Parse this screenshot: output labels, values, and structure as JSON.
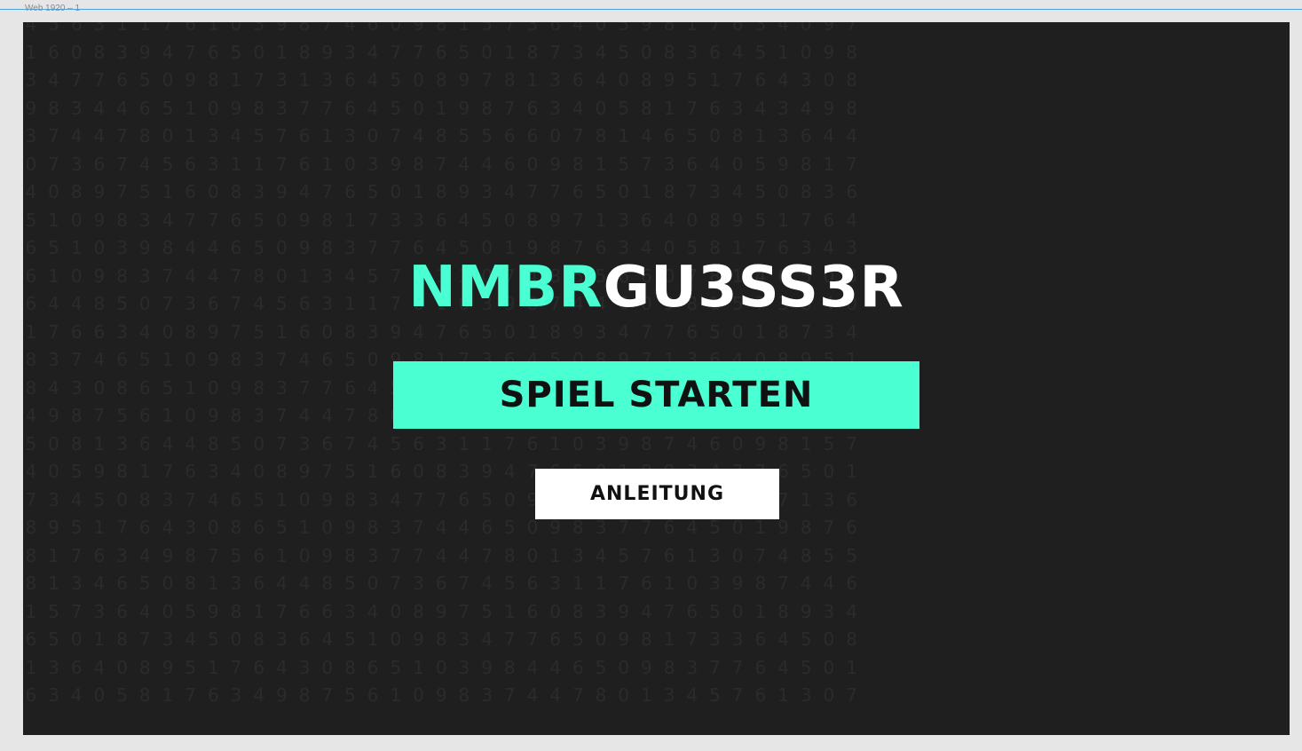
{
  "canvas": {
    "artboard_label": "Web 1920 – 1"
  },
  "title": {
    "accent": "NMBR",
    "rest": "GU3SS3R"
  },
  "buttons": {
    "start_label": "SPIEL STARTEN",
    "guide_label": "ANLEITUNG"
  },
  "background_digits": [
    "4563117610398746098157364059817634097",
    "1608394765018934776501873450836451098",
    "3477650981731364508978136408951764308",
    "9834465109837764501987634058176343498",
    "3744780134576130748556607814650813644",
    "0736745631176103987446098157364059817",
    "4089751608394765018934776501873450836",
    "5109834776509817336450897136408951764",
    "6510398446509837764501987634058176343",
    "6109837447801345761307485566078146508",
    "6448507367456311761039874460981573640",
    "1766340897516083947650189347765018734",
    "8374651098374650981736450897136408951",
    "8430865109837764501987634058176343498",
    "4987561098374478013457613074855660781",
    "5081364485073674563117610398746098157",
    "4059817634089751608394765018934776501",
    "7345083746510983477650981736450897136",
    "8951764308651098374465098377645019876",
    "8176349875610983774478013457613074855",
    "8134650813644850736745631176103987446",
    "1573640598176634089751608394765018934",
    "6501873450836451098347765098173364508",
    "1364089517643086510398446509837764501",
    "6340581763498756109837447801345761307"
  ],
  "colors": {
    "accent": "#4affd2",
    "background": "#1f1f1f",
    "title_rest": "#ffffff",
    "guide_button_bg": "#ffffff",
    "button_text": "#111111",
    "digits": "#2b2b2b"
  }
}
